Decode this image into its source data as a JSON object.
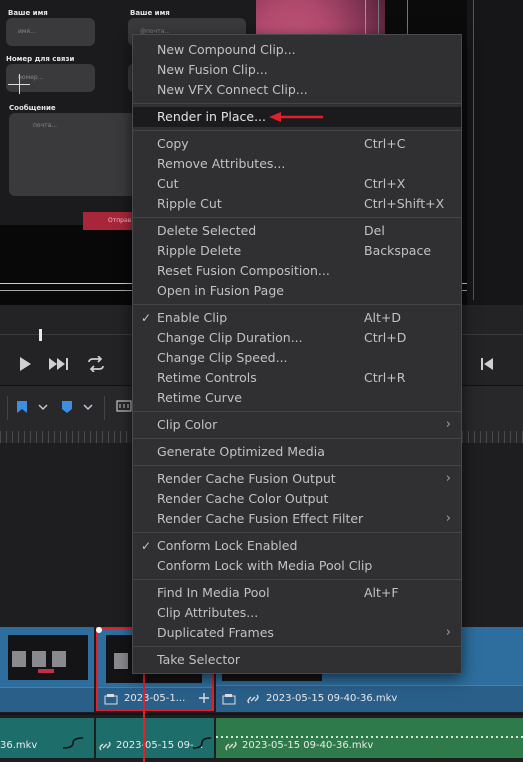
{
  "form": {
    "name_label": "Ваше имя",
    "name_placeholder": "имя...",
    "email_label": "Ваше имя",
    "email_placeholder": "@почта...",
    "phone_label": "Номер для связи",
    "phone_placeholder": "номер...",
    "message_label": "Сообщение",
    "message_placeholder": "почта...",
    "send_label": "Отправ"
  },
  "menu": {
    "items": [
      {
        "label": "New Compound Clip..."
      },
      {
        "label": "New Fusion Clip..."
      },
      {
        "label": "New VFX Connect Clip..."
      },
      {
        "label": "Render in Place..."
      },
      {
        "label": "Copy",
        "shortcut": "Ctrl+C"
      },
      {
        "label": "Remove Attributes..."
      },
      {
        "label": "Cut",
        "shortcut": "Ctrl+X"
      },
      {
        "label": "Ripple Cut",
        "shortcut": "Ctrl+Shift+X"
      },
      {
        "label": "Delete Selected",
        "shortcut": "Del"
      },
      {
        "label": "Ripple Delete",
        "shortcut": "Backspace"
      },
      {
        "label": "Reset Fusion Composition..."
      },
      {
        "label": "Open in Fusion Page"
      },
      {
        "label": "Enable Clip",
        "shortcut": "Alt+D"
      },
      {
        "label": "Change Clip Duration...",
        "shortcut": "Ctrl+D"
      },
      {
        "label": "Change Clip Speed..."
      },
      {
        "label": "Retime Controls",
        "shortcut": "Ctrl+R"
      },
      {
        "label": "Retime Curve"
      },
      {
        "label": "Clip Color"
      },
      {
        "label": "Generate Optimized Media"
      },
      {
        "label": "Render Cache Fusion Output"
      },
      {
        "label": "Render Cache Color Output"
      },
      {
        "label": "Render Cache Fusion Effect Filter"
      },
      {
        "label": "Conform Lock Enabled"
      },
      {
        "label": "Conform Lock with Media Pool Clip"
      },
      {
        "label": "Find In Media Pool",
        "shortcut": "Alt+F"
      },
      {
        "label": "Clip Attributes..."
      },
      {
        "label": "Duplicated Frames"
      },
      {
        "label": "Take Selector"
      }
    ]
  },
  "timeline": {
    "clip1_label": "2023-05-1...",
    "clip2_label": "2023-05-15 09-40-36.mkv",
    "audio1_label": "36.mkv",
    "audio2_label": "2023-05-15 09-...",
    "audio3_label": "2023-05-15 09-40-36.mkv"
  },
  "colors": {
    "accent_red": "#e0202a",
    "menu_bg": "#303033",
    "video_clip": "#2d6e9e",
    "audio_clip": "#1d6d6a"
  }
}
